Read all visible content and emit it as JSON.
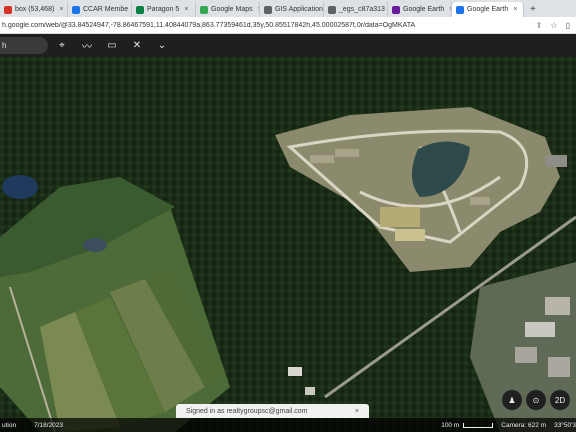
{
  "tabs": [
    {
      "label": "box (53,468)",
      "color": "#d93025"
    },
    {
      "label": "CCAR Membe",
      "color": "#1a73e8"
    },
    {
      "label": "Paragon 5",
      "color": "#0b8043"
    },
    {
      "label": "Google Maps",
      "color": "#34a853"
    },
    {
      "label": "GIS Application",
      "color": "#5f6368"
    },
    {
      "label": "_egs_c87a313",
      "color": "#5f6368"
    },
    {
      "label": "Google Earth",
      "color": "#6a1b9a"
    },
    {
      "label": "Google Earth",
      "color": "#1a73e8"
    }
  ],
  "new_tab": "+",
  "address": {
    "url": "h.google.com/web/@33.84524947,-78.86467591,11.40844079a,863.77359461d,35y,50.85517842h,45.00002587t,0r/data=OgMKATA"
  },
  "toolbar": {
    "search_text": "h",
    "icons": [
      "map-pin-icon",
      "path-icon",
      "ruler-icon",
      "no-satellite-icon",
      "chevron-down-icon"
    ]
  },
  "status": {
    "left": "ution",
    "date": "7/18/2023",
    "scale": "100 m",
    "camera": "Camera: 622 m",
    "coords": "33°50'3"
  },
  "toast": {
    "text": "Signed in as realtygroupsc@gmail.com",
    "close": "×"
  },
  "controls": {
    "pegman": "♟",
    "compass": "⊙",
    "view": "2D"
  }
}
